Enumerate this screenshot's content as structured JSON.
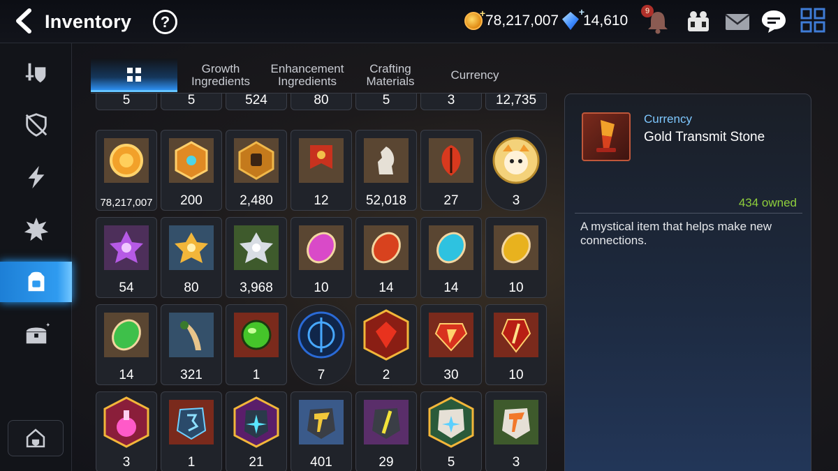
{
  "header": {
    "title": "Inventory",
    "help_label": "?",
    "gold": "78,217,007",
    "crystals": "14,610",
    "notification_count": "9"
  },
  "sidebar": {
    "items": [
      {
        "icon": "sword-shield-icon",
        "active": false
      },
      {
        "icon": "shield-icon",
        "active": false
      },
      {
        "icon": "lightning-icon",
        "active": false
      },
      {
        "icon": "splash-icon",
        "active": false
      },
      {
        "icon": "backpack-icon",
        "active": true
      },
      {
        "icon": "chest-icon",
        "active": false
      }
    ],
    "bottom_icon": "guild-house-icon"
  },
  "tabs": [
    {
      "label": "",
      "icon": "grid-icon",
      "active": true
    },
    {
      "label": "Growth\nIngredients",
      "active": false
    },
    {
      "label": "Enhancement\nIngredients",
      "active": false
    },
    {
      "label": "Crafting\nMaterials",
      "active": false
    },
    {
      "label": "Currency",
      "active": false
    }
  ],
  "grid": {
    "partial_row": [
      "5",
      "5",
      "524",
      "80",
      "5",
      "3",
      "12,735"
    ],
    "rows": [
      [
        {
          "icon": "gold-coin-icon",
          "count": "78,217,007"
        },
        {
          "icon": "gold-hexagon-badge-icon",
          "count": "200"
        },
        {
          "icon": "fist-emblem-icon",
          "count": "2,480"
        },
        {
          "icon": "war-banner-icon",
          "count": "12"
        },
        {
          "icon": "chess-knight-icon",
          "count": "52,018"
        },
        {
          "icon": "red-leaf-icon",
          "count": "27"
        },
        {
          "icon": "character-portrait-icon",
          "count": "3"
        }
      ],
      [
        {
          "icon": "purple-flower-icon",
          "count": "54"
        },
        {
          "icon": "gold-flower-icon",
          "count": "80"
        },
        {
          "icon": "silver-flower-icon",
          "count": "3,968"
        },
        {
          "icon": "pink-rune-icon",
          "count": "10"
        },
        {
          "icon": "red-rune-icon",
          "count": "14"
        },
        {
          "icon": "cyan-rune-icon",
          "count": "14"
        },
        {
          "icon": "yellow-rune-icon",
          "count": "10"
        }
      ],
      [
        {
          "icon": "green-rune-icon",
          "count": "14"
        },
        {
          "icon": "root-herb-icon",
          "count": "321"
        },
        {
          "icon": "green-orb-icon",
          "count": "1"
        },
        {
          "icon": "blue-sigil-icon",
          "count": "7"
        },
        {
          "icon": "red-gem-hexagon-icon",
          "count": "2"
        },
        {
          "icon": "red-stone-icon",
          "count": "30"
        },
        {
          "icon": "red-shard-icon",
          "count": "10"
        }
      ],
      [
        {
          "icon": "pink-potion-icon",
          "count": "3"
        },
        {
          "icon": "blue-rune-stone-icon",
          "count": "1"
        },
        {
          "icon": "teal-crystal-icon",
          "count": "21"
        },
        {
          "icon": "gold-stone-icon",
          "count": "401"
        },
        {
          "icon": "yellow-stone-icon",
          "count": "29"
        },
        {
          "icon": "white-stone-icon",
          "count": "5"
        },
        {
          "icon": "orange-stone-icon",
          "count": "3"
        }
      ]
    ]
  },
  "detail": {
    "category": "Currency",
    "name": "Gold Transmit Stone",
    "owned": "434 owned",
    "description": "A mystical item that helps make new connections.",
    "icon": "gold-transmit-stone-icon"
  },
  "colors": {
    "accent_blue": "#2f9bf0",
    "owned_green": "#8fcf3c",
    "category_blue": "#7ec8ff"
  }
}
